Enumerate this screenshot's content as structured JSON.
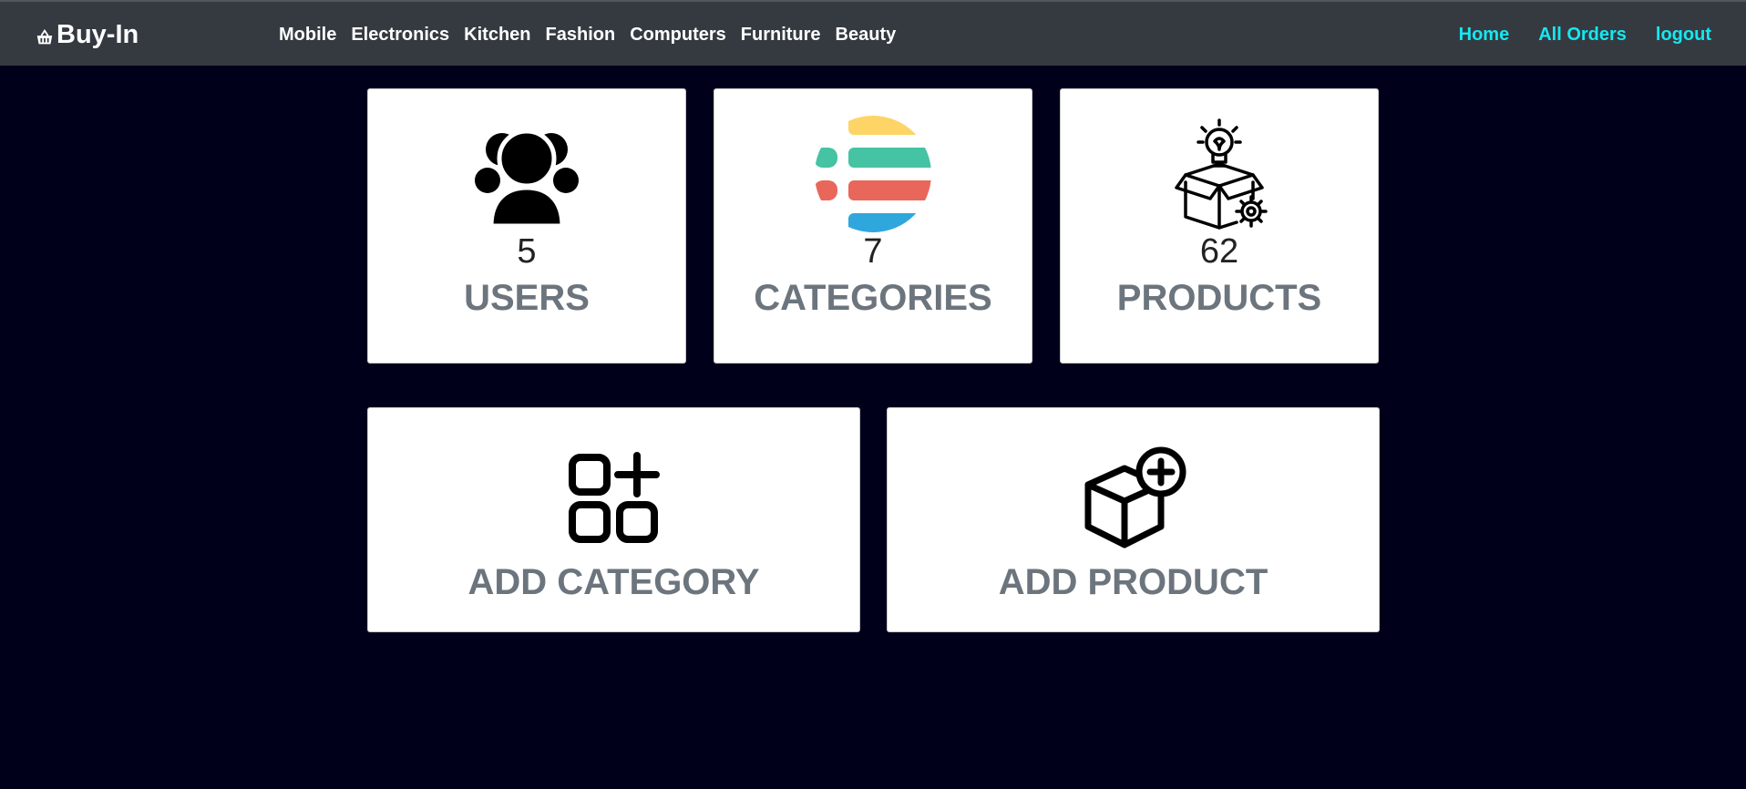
{
  "nav": {
    "brand": "Buy-In",
    "categories": [
      "Mobile",
      "Electronics",
      "Kitchen",
      "Fashion",
      "Computers",
      "Furniture",
      "Beauty"
    ],
    "links": [
      "Home",
      "All Orders",
      "logout"
    ]
  },
  "stats": {
    "users": {
      "count": "5",
      "label": "USERS",
      "icon": "users-icon"
    },
    "categories": {
      "count": "7",
      "label": "CATEGORIES",
      "icon": "categories-icon"
    },
    "products": {
      "count": "62",
      "label": "PRODUCTS",
      "icon": "products-icon"
    }
  },
  "actions": {
    "add_category": {
      "label": "ADD CATEGORY",
      "icon": "add-category-icon"
    },
    "add_product": {
      "label": "ADD PRODUCT",
      "icon": "add-product-icon"
    }
  },
  "colors": {
    "background": "#00001a",
    "navbar": "#343a40",
    "link_accent": "#17e7f0",
    "label_gray": "#6c757d"
  }
}
